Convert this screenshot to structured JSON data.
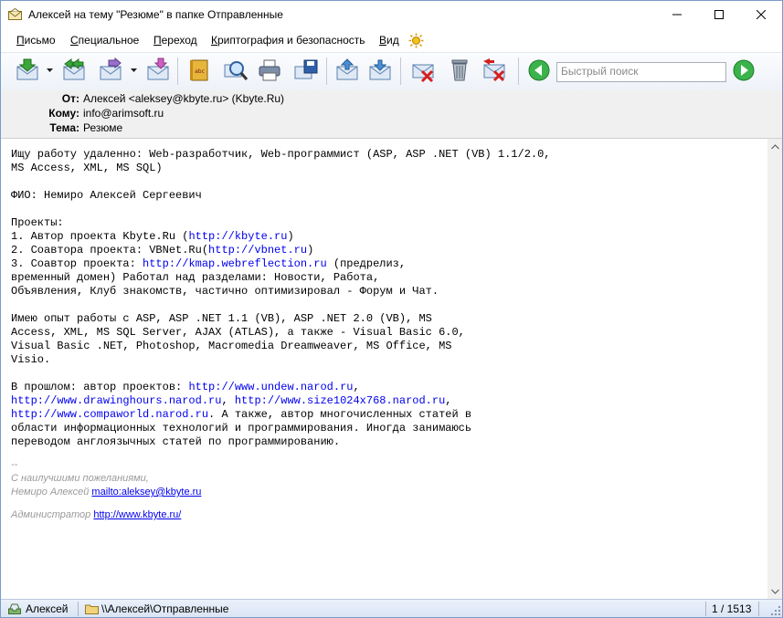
{
  "window": {
    "title": "Алексей на тему \"Резюме\" в папке Отправленные"
  },
  "menu": [
    {
      "label": "Письмо",
      "u": "П",
      "rest": "исьмо"
    },
    {
      "label": "Специальное",
      "u": "С",
      "rest": "пециальное"
    },
    {
      "label": "Переход",
      "u": "П",
      "rest": "ереход"
    },
    {
      "label": "Криптография и безопасность",
      "u": "К",
      "rest": "риптография и безопасность"
    },
    {
      "label": "Вид",
      "u": "В",
      "rest": "ид"
    }
  ],
  "search": {
    "placeholder": "Быстрый поиск"
  },
  "headers": {
    "from_label": "От:",
    "from_value": "Алексей <aleksey@kbyte.ru>  (Kbyte.Ru)",
    "to_label": "Кому:",
    "to_value": "info@arimsoft.ru",
    "subject_label": "Тема:",
    "subject_value": "Резюме"
  },
  "body": {
    "l1": "Ищу работу удаленно: Web-разработчик, Web-программист (ASP, ASP .NET (VB) 1.1/2.0,",
    "l2": "MS Access, XML, MS SQL)",
    "l3": "ФИО: Немиро Алексей Сергеевич",
    "l4": "Проекты:",
    "l5a": "1. Автор проекта Kbyte.Ru (",
    "l5link": "http://kbyte.ru",
    "l5b": ")",
    "l6a": "2. Соавтора проекта: VBNet.Ru(",
    "l6link": "http://vbnet.ru",
    "l6b": ")",
    "l7a": "3. Соавтор проекта: ",
    "l7link": "http://kmap.webreflection.ru",
    "l7b": " (предрелиз,",
    "l8": "временный домен) Работал над разделами: Новости, Работа,",
    "l9": "Объявления, Клуб знакомств, частично оптимизировал - Форум и Чат.",
    "l10": "Имею опыт работы с ASP, ASP .NET 1.1 (VB), ASP .NET 2.0 (VB), MS",
    "l11": "Access, XML, MS SQL Server, AJAX (ATLAS), а также - Visual Basic 6.0,",
    "l12": "Visual Basic .NET, Photoshop, Macromedia Dreamweaver, MS Office, MS",
    "l13": "Visio.",
    "l14a": "В прошлом: автор проектов: ",
    "l14link": "http://www.undew.narod.ru",
    "l14b": ",",
    "l15link1": "http://www.drawinghours.narod.ru",
    "l15mid": ", ",
    "l15link2": "http://www.size1024x768.narod.ru",
    "l15b": ",",
    "l16link": "http://www.compaworld.narod.ru",
    "l16b": ". А также, автор многочисленных статей в",
    "l17": "области информационных технологий и программирования. Иногда занимаюсь",
    "l18": "переводом англоязычных статей по программированию."
  },
  "signature": {
    "dashes": "--",
    "regards": "С наилучшими пожеланиями,",
    "name": "Немиро Алексей ",
    "mailto": "mailto:aleksey@kbyte.ru",
    "admin": "Администратор ",
    "admin_link": "http://www.kbyte.ru/"
  },
  "status": {
    "user": "Алексей",
    "folder": "\\\\Алексей\\Отправленные",
    "count": "1 / 1513"
  }
}
